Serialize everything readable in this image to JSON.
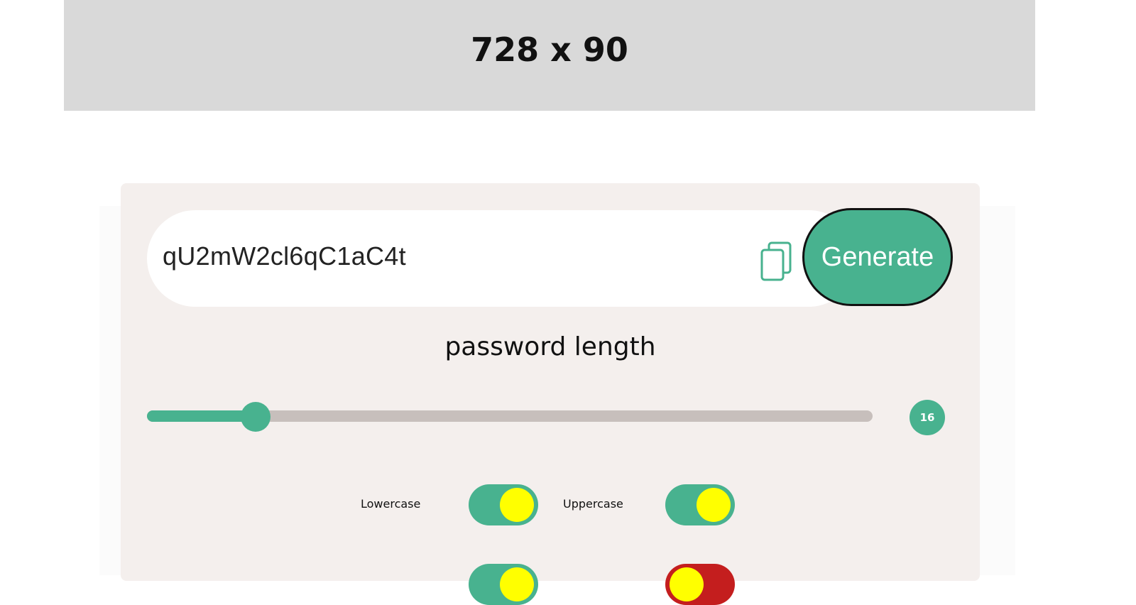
{
  "ad": {
    "label": "728 x 90"
  },
  "generator": {
    "password": "qU2mW2cl6qC1aC4t",
    "copy_icon": "copy-icon",
    "generate_label": "Generate"
  },
  "length": {
    "title": "password length",
    "value": "16",
    "slider_fraction": 0.15
  },
  "options": [
    {
      "label": "Lowercase",
      "enabled": true
    },
    {
      "label": "Uppercase",
      "enabled": true
    },
    {
      "label": "",
      "enabled": true
    },
    {
      "label": "",
      "enabled": false
    }
  ],
  "colors": {
    "accent": "#48b28f",
    "card": "#f4efed",
    "knob": "#ffff00",
    "toggle_off": "#c41e1e",
    "ad_bg": "#d9d9d9"
  }
}
